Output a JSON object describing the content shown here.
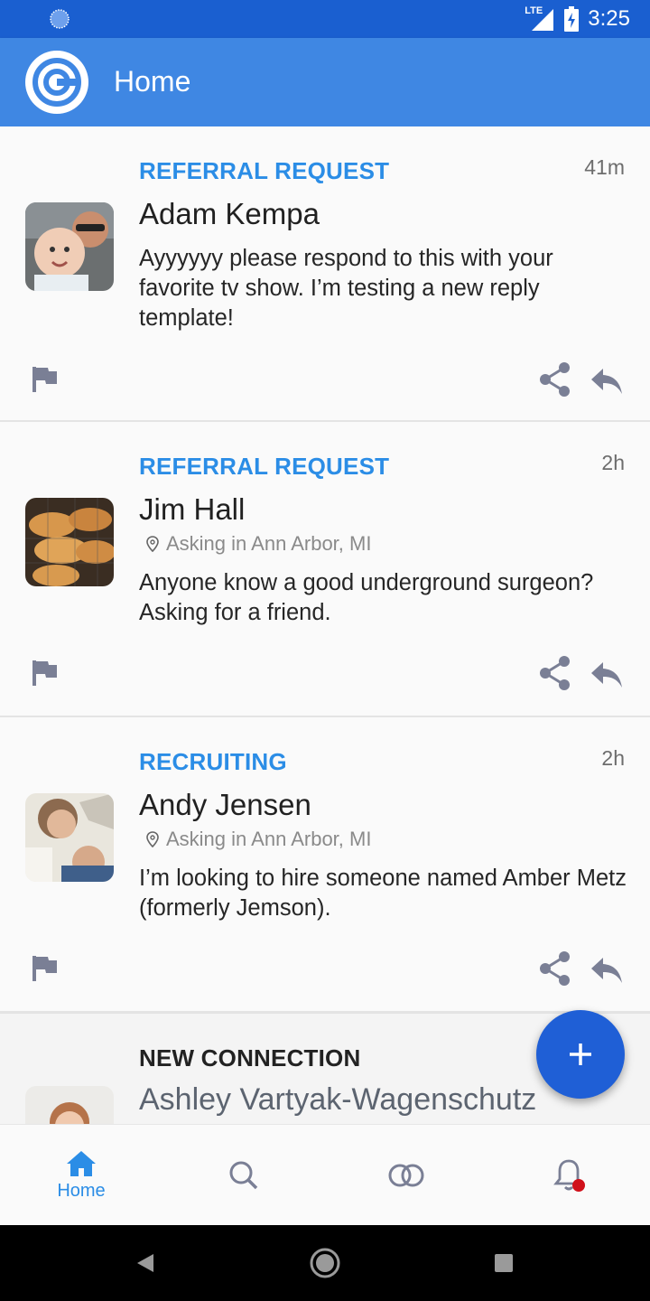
{
  "status_bar": {
    "time": "3:25",
    "network_label": "LTE",
    "icons": [
      "loading-spinner-icon",
      "signal-icon",
      "battery-charging-icon"
    ]
  },
  "app_bar": {
    "title": "Home",
    "logo_icon": "app-logo-icon"
  },
  "feed": {
    "posts": [
      {
        "category": "REFERRAL REQUEST",
        "time": "41m",
        "name": "Adam Kempa",
        "location": "",
        "body": "Ayyyyyy please respond to this with your favorite tv show. I’m testing a new reply template!"
      },
      {
        "category": "REFERRAL REQUEST",
        "time": "2h",
        "name": "Jim Hall",
        "location": "Asking in Ann Arbor, MI",
        "body": "Anyone know a good underground surgeon? Asking for a friend."
      },
      {
        "category": "RECRUITING",
        "time": "2h",
        "name": "Andy Jensen",
        "location": "Asking in Ann Arbor, MI",
        "body": "I’m looking to hire someone named Amber Metz (formerly Jemson)."
      }
    ],
    "new_connection": {
      "category": "NEW CONNECTION",
      "name": "Ashley Vartyak-Wagenschutz"
    }
  },
  "fab": {
    "icon": "plus-icon"
  },
  "bottom_nav": {
    "items": [
      {
        "label": "Home",
        "icon": "home-icon",
        "active": true
      },
      {
        "label": "",
        "icon": "search-icon",
        "active": false
      },
      {
        "label": "",
        "icon": "connections-icon",
        "active": false
      },
      {
        "label": "",
        "icon": "bell-icon",
        "active": false,
        "badge": true
      }
    ]
  },
  "colors": {
    "status_bar": "#1a5fd0",
    "app_bar": "#3f87e3",
    "accent": "#2b8de6",
    "fab": "#1f5fd6",
    "icon_gray": "#7a7f95",
    "badge": "#d0101a"
  }
}
